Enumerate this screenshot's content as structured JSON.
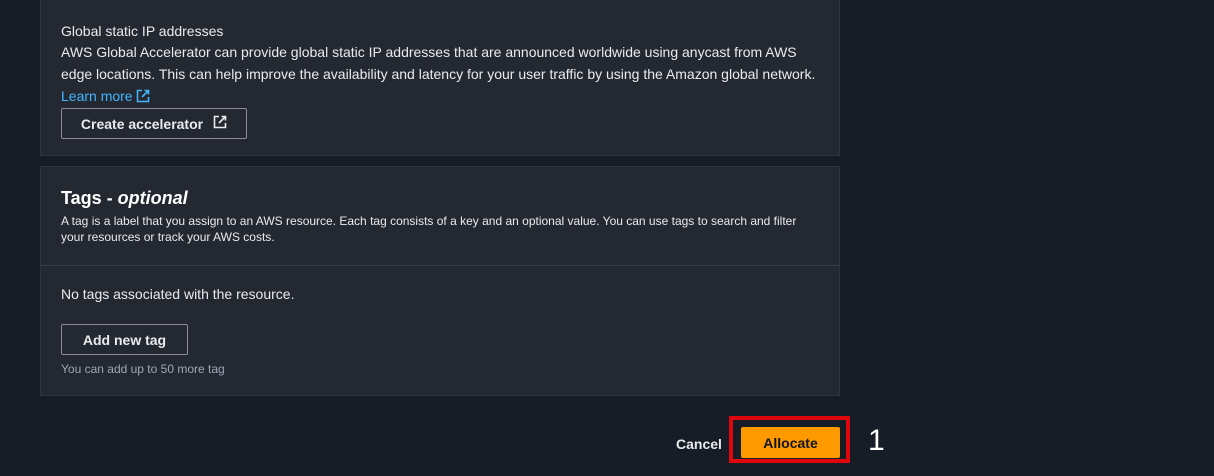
{
  "global_ip": {
    "title": "Global static IP addresses",
    "description": "AWS Global Accelerator can provide global static IP addresses that are announced worldwide using anycast from AWS edge locations. This can help improve the availability and latency for your user traffic by using the Amazon global network.",
    "learn_more": "Learn more",
    "create_button": "Create accelerator"
  },
  "tags": {
    "title": "Tags - ",
    "title_optional": "optional",
    "description": "A tag is a label that you assign to an AWS resource. Each tag consists of a key and an optional value. You can use tags to search and filter your resources or track your AWS costs.",
    "empty_message": "No tags associated with the resource.",
    "add_button": "Add new tag",
    "hint": "You can add up to 50 more tag"
  },
  "footer": {
    "cancel": "Cancel",
    "allocate": "Allocate"
  },
  "annotation": {
    "step_number": "1"
  },
  "colors": {
    "background": "#161d26",
    "panel": "#242931",
    "link": "#42b4ff",
    "primary_button": "#ff9900",
    "highlight_box": "#e0070c"
  },
  "icons": {
    "external_link": "external-link-icon"
  }
}
